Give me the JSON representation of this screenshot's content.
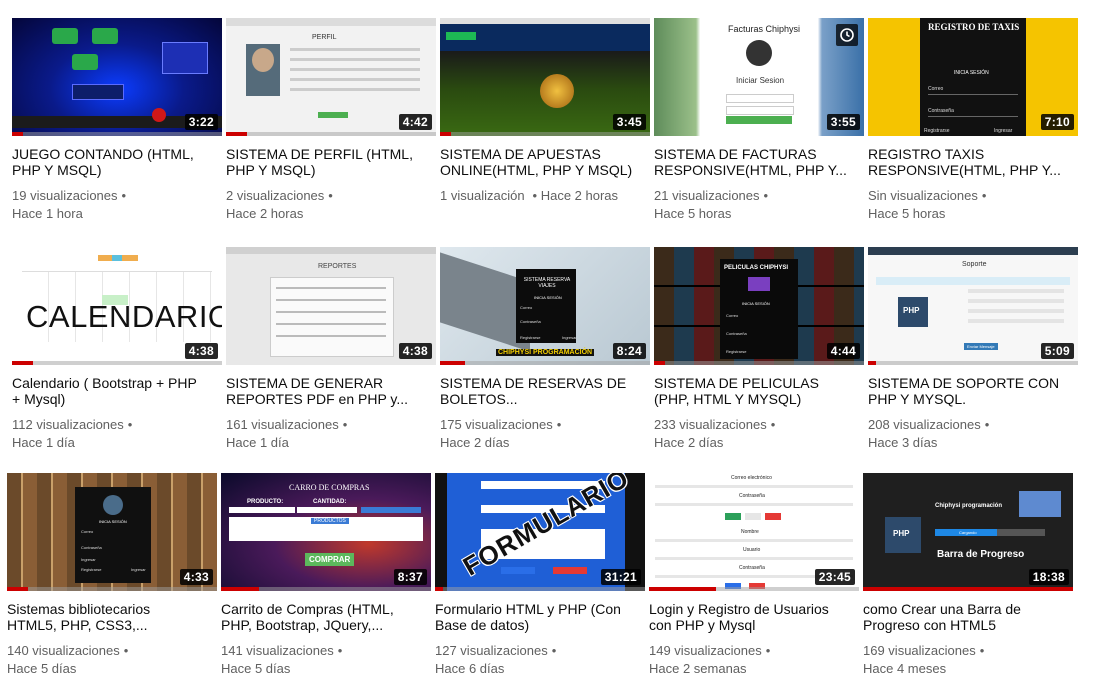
{
  "videos": [
    {
      "title": "JUEGO CONTANDO (HTML,\nPHP Y MSQL)",
      "views": "19 visualizaciones",
      "age": "Hace 1 hora",
      "duration": "3:22",
      "progress": 0.05
    },
    {
      "title": "SISTEMA DE PERFIL (HTML,\nPHP Y MSQL)",
      "views": "2 visualizaciones",
      "age": "Hace 2 horas",
      "duration": "4:42",
      "progress": 0.1
    },
    {
      "title": "SISTEMA DE APUESTAS\nONLINE(HTML, PHP Y MSQL)",
      "views": "1 visualización",
      "age": "Hace 2 horas",
      "duration": "3:45",
      "progress": 0.05
    },
    {
      "title": "SISTEMA DE FACTURAS\nRESPONSIVE(HTML, PHP Y...",
      "views": "21 visualizaciones",
      "age": "Hace 5 horas",
      "duration": "3:55",
      "progress": 0.0
    },
    {
      "title": "REGISTRO TAXIS\nRESPONSIVE(HTML, PHP Y...",
      "views": "Sin visualizaciones",
      "age": "Hace 5 horas",
      "duration": "7:10",
      "progress": 0.0
    },
    {
      "title": "Calendario ( Bootstrap + PHP\n+ Mysql)",
      "views": "112 visualizaciones",
      "age": "Hace 1 día",
      "duration": "4:38",
      "progress": 0.1
    },
    {
      "title": "SISTEMA DE GENERAR\nREPORTES PDF en PHP y...",
      "views": "161 visualizaciones",
      "age": "Hace 1 día",
      "duration": "4:38",
      "progress": 0.0
    },
    {
      "title": "SISTEMA DE RESERVAS DE\nBOLETOS...",
      "views": "175 visualizaciones",
      "age": "Hace 2 días",
      "duration": "8:24",
      "progress": 0.12
    },
    {
      "title": "SISTEMA DE PELICULAS\n(PHP, HTML Y MYSQL)",
      "views": "233 visualizaciones",
      "age": "Hace 2 días",
      "duration": "4:44",
      "progress": 0.05
    },
    {
      "title": "SISTEMA DE SOPORTE CON\nPHP Y MYSQL.",
      "views": "208 visualizaciones",
      "age": "Hace 3 días",
      "duration": "5:09",
      "progress": 0.04
    },
    {
      "title": "Sistemas bibliotecarios\nHTML5, PHP, CSS3,...",
      "views": "140 visualizaciones",
      "age": "Hace 5 días",
      "duration": "4:33",
      "progress": 0.1
    },
    {
      "title": "Carrito de Compras (HTML,\nPHP, Bootstrap, JQuery,...",
      "views": "141 visualizaciones",
      "age": "Hace 5 días",
      "duration": "8:37",
      "progress": 0.18
    },
    {
      "title": "Formulario HTML y PHP (Con\nBase de datos)",
      "views": "127 visualizaciones",
      "age": "Hace 6 días",
      "duration": "31:21",
      "progress": 0.04
    },
    {
      "title": "Login y Registro de Usuarios\ncon PHP y Mysql",
      "views": "149 visualizaciones",
      "age": "Hace 2 semanas",
      "duration": "23:45",
      "progress": 0.32
    },
    {
      "title": "como Crear una Barra de\nProgreso con HTML5",
      "views": "169 visualizaciones",
      "age": "Hace 4 meses",
      "duration": "18:38",
      "progress": 1.0
    }
  ],
  "thumb_text": {
    "perfil": "PERFIL",
    "facturas_title": "Facturas Chiphysi",
    "facturas_login": "Iniciar Sesion",
    "taxis_title": "REGISTRO DE TAXIS",
    "taxis_sub": "INICIA SESIÓN",
    "taxis_f1": "Correo",
    "taxis_f2": "Contraseña",
    "taxis_l": "Registrarse",
    "taxis_r": "Ingresar",
    "calendario": "CALENDARIO",
    "reportes": "REPORTES",
    "reservas_title": "SISTEMA RESERVA VIAJES",
    "reservas_sub": "INICIA SESIÓN",
    "reservas_f1": "Correo",
    "reservas_f2": "Contraseña",
    "reservas_l": "Registrarse",
    "reservas_r": "Ingresar",
    "reservas_brand": "CHIPHYSI PROGRAMACIÓN",
    "peliculas_title": "PELICULAS CHIPHYSI",
    "peliculas_sub": "INICIA SESIÓN",
    "peliculas_f1": "Correo",
    "peliculas_f2": "Contraseña",
    "peliculas_l": "Registrarse",
    "soporte_title": "Soporte",
    "soporte_btn": "Enviar Mensaje",
    "php": "PHP",
    "biblio_sub": "INICIA SESIÓN",
    "biblio_f1": "Correo",
    "biblio_f2": "Contraseña",
    "biblio_f3": "Ingresar",
    "biblio_l": "Registrarse",
    "biblio_r": "Ingresar",
    "carrito_title": "CARRO DE COMPRAS",
    "carrito_producto": "PRODUCTO:",
    "carrito_cantidad": "CANTIDAD:",
    "carrito_productos": "PRODUCTOS",
    "carrito_btn": "COMPRAR",
    "formulario": "FORMULARIO",
    "login_correo": "Correo electrónico",
    "login_pass": "Contraseña",
    "login_nombre": "Nombre",
    "login_usuario": "Usuario",
    "login_pass2": "Contraseña",
    "barra_brand": "Chiphysi programación",
    "barra_cargando": "Cargando",
    "barra_title": "Barra de Progreso"
  },
  "colors": {
    "progress_red": "#cc0000",
    "title": "#0d0d0d",
    "meta": "#606060",
    "taxi_yellow": "#f5c400"
  }
}
